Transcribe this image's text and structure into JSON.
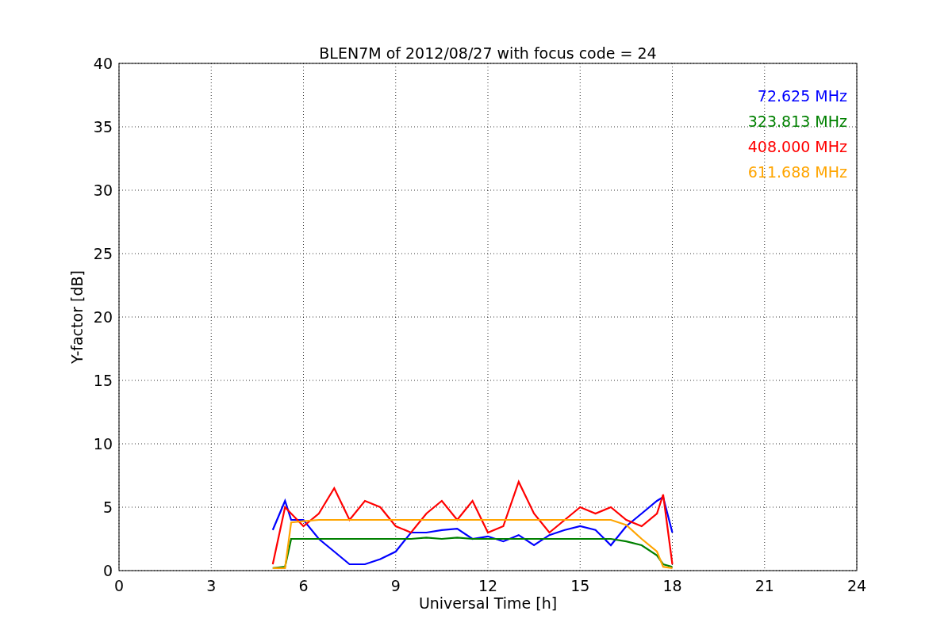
{
  "figure": {
    "chart_data": {
      "type": "line",
      "title": "BLEN7M of 2012/08/27 with focus code = 24",
      "xlabel": "Universal Time [h]",
      "ylabel": "Y-factor [dB]",
      "x": [
        5,
        5.4,
        5.6,
        6,
        6.5,
        7,
        7.5,
        8,
        8.5,
        9,
        9.5,
        10,
        10.5,
        11,
        11.5,
        12,
        12.5,
        13,
        13.5,
        14,
        14.5,
        15,
        15.5,
        16,
        16.5,
        17,
        17.5,
        17.7,
        18
      ],
      "series": [
        {
          "name": "72.625 MHz",
          "color": "#0000ff",
          "values": [
            3.2,
            5.5,
            4,
            4,
            2.5,
            1.5,
            0.5,
            0.5,
            0.9,
            1.5,
            3,
            3,
            3.2,
            3.3,
            2.5,
            2.7,
            2.3,
            2.8,
            2,
            2.8,
            3.2,
            3.5,
            3.2,
            2,
            3.5,
            4.5,
            5.5,
            5.8,
            3
          ]
        },
        {
          "name": "323.813 MHz",
          "color": "#008000",
          "values": [
            0.2,
            0.3,
            2.5,
            2.5,
            2.5,
            2.5,
            2.5,
            2.5,
            2.5,
            2.5,
            2.5,
            2.6,
            2.5,
            2.6,
            2.5,
            2.5,
            2.5,
            2.5,
            2.5,
            2.5,
            2.5,
            2.5,
            2.5,
            2.5,
            2.3,
            2,
            1.2,
            0.5,
            0.3
          ]
        },
        {
          "name": "408.000 MHz",
          "color": "#ff0000",
          "values": [
            0.5,
            5,
            4.5,
            3.5,
            4.5,
            6.5,
            4,
            5.5,
            5,
            3.5,
            3,
            4.5,
            5.5,
            4,
            5.5,
            3,
            3.5,
            7,
            4.5,
            3,
            4,
            5,
            4.5,
            5,
            4,
            3.5,
            4.5,
            6,
            0.5
          ]
        },
        {
          "name": "611.688 MHz",
          "color": "#ffa500",
          "values": [
            0.2,
            0.2,
            3.8,
            3.9,
            4,
            4,
            4,
            4,
            4,
            4,
            4,
            4,
            4,
            4,
            4,
            4,
            4,
            4,
            4,
            4,
            4,
            4,
            4,
            4,
            3.6,
            2.5,
            1.5,
            0.3,
            0.2
          ]
        }
      ],
      "grid": true,
      "xlim": [
        0,
        24
      ],
      "ylim": [
        0,
        40
      ],
      "xticks": [
        0,
        3,
        6,
        9,
        12,
        15,
        18,
        21,
        24
      ],
      "yticks": [
        0,
        5,
        10,
        15,
        20,
        25,
        30,
        35,
        40
      ]
    }
  }
}
